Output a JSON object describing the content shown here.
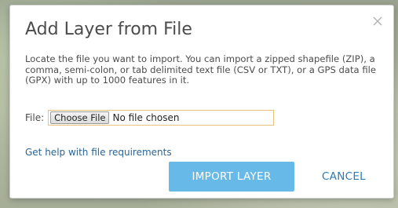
{
  "dialog": {
    "title": "Add Layer from File",
    "description": "Locate the file you want to import. You can import a zipped shapefile (ZIP), a comma, semi-colon, or tab delimited text file (CSV or TXT), or a GPS data file (GPX) with up to 1000 features in it.",
    "file_label": "File:",
    "choose_file_label": "Choose File",
    "no_file_text": "No file chosen",
    "help_link": "Get help with file requirements",
    "import_label": "IMPORT LAYER",
    "cancel_label": "CANCEL"
  },
  "colors": {
    "accent": "#67b9e7",
    "link": "#2a6496",
    "file_box_border": "#e8c27a"
  },
  "icons": {
    "close": "close-icon"
  }
}
